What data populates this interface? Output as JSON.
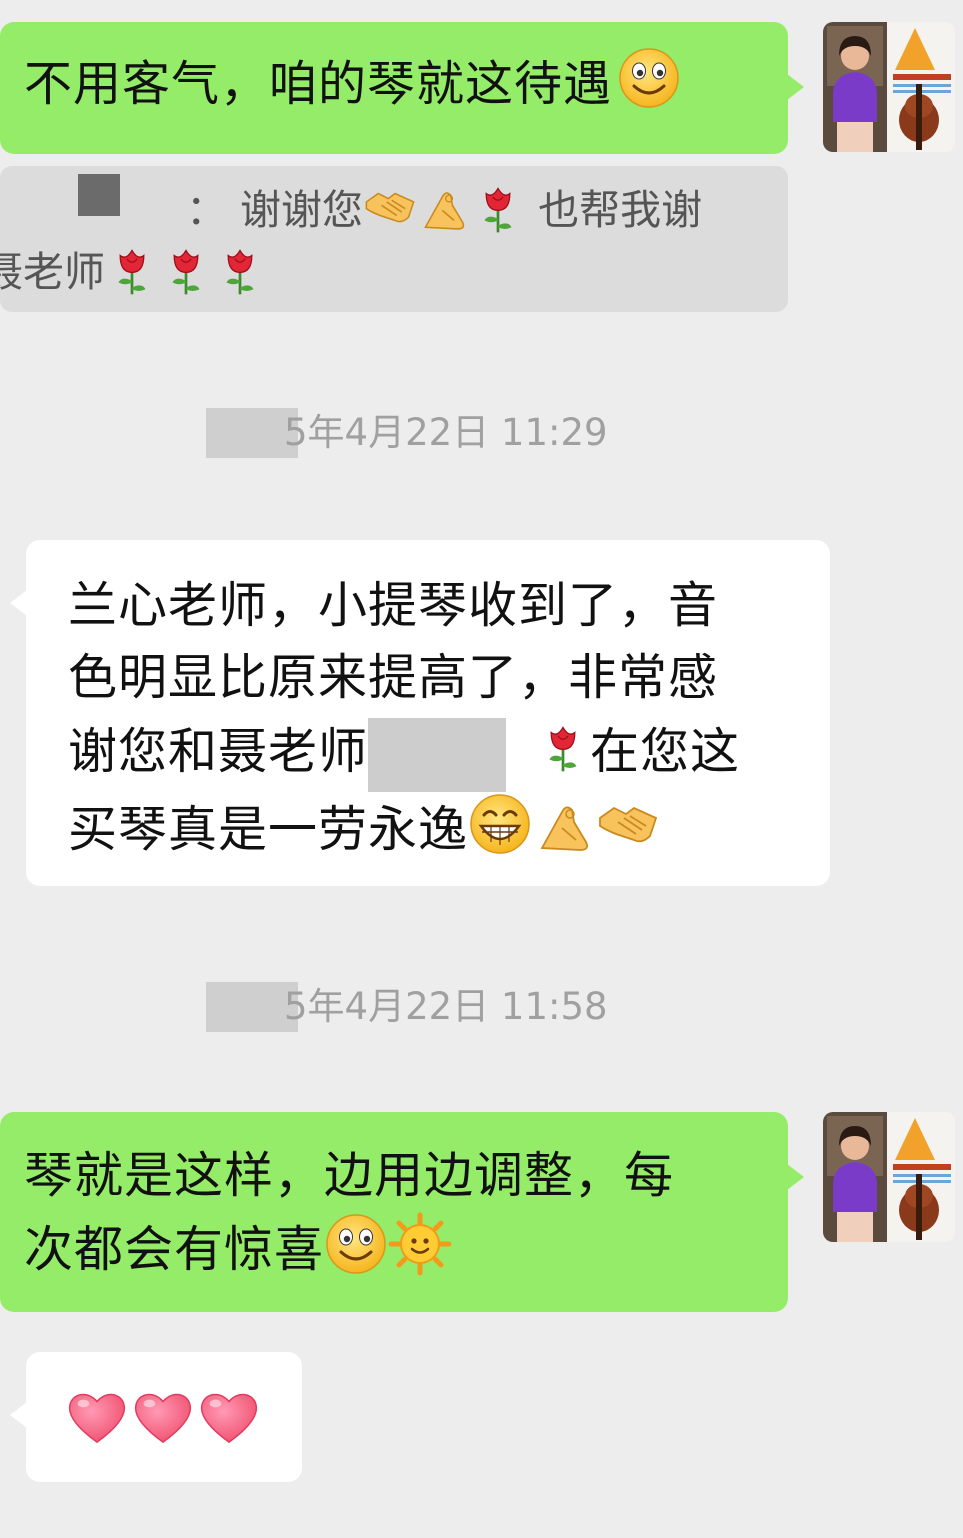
{
  "messages": [
    {
      "id": "msg1",
      "text_a": "不用客气，咱的琴就这待遇",
      "emoji": "smiling-face"
    },
    {
      "id": "quote",
      "separator": "：",
      "text_a": "谢谢您",
      "text_b": "也帮我谢",
      "text_c": "聂老师"
    },
    {
      "id": "ts1",
      "text": "5年4月22日 11:29"
    },
    {
      "id": "msg2",
      "line1": "兰心老师，小提琴收到了，音",
      "line2": "色明显比原来提高了，非常感",
      "line3a": "谢您和聂老师",
      "line3b": "在您这",
      "line4": "买琴真是一劳永逸"
    },
    {
      "id": "ts2",
      "text": "5年4月22日 11:58"
    },
    {
      "id": "msg3",
      "line1": "琴就是这样，边用边调整，每",
      "line2": "次都会有惊喜"
    },
    {
      "id": "msg4",
      "hearts": 3
    }
  ],
  "colors": {
    "background": "#ededed",
    "outgoing_bubble": "#95ec69",
    "incoming_bubble": "#ffffff",
    "quote_bubble": "#dcdcdc",
    "timestamp": "#a0a0a0",
    "redaction": "#cdcdcd"
  },
  "icons": [
    "smiling-face-icon",
    "handshake-icon",
    "ok-hand-icon",
    "rose-icon",
    "grinning-face-icon",
    "sun-face-icon",
    "heart-icon"
  ]
}
